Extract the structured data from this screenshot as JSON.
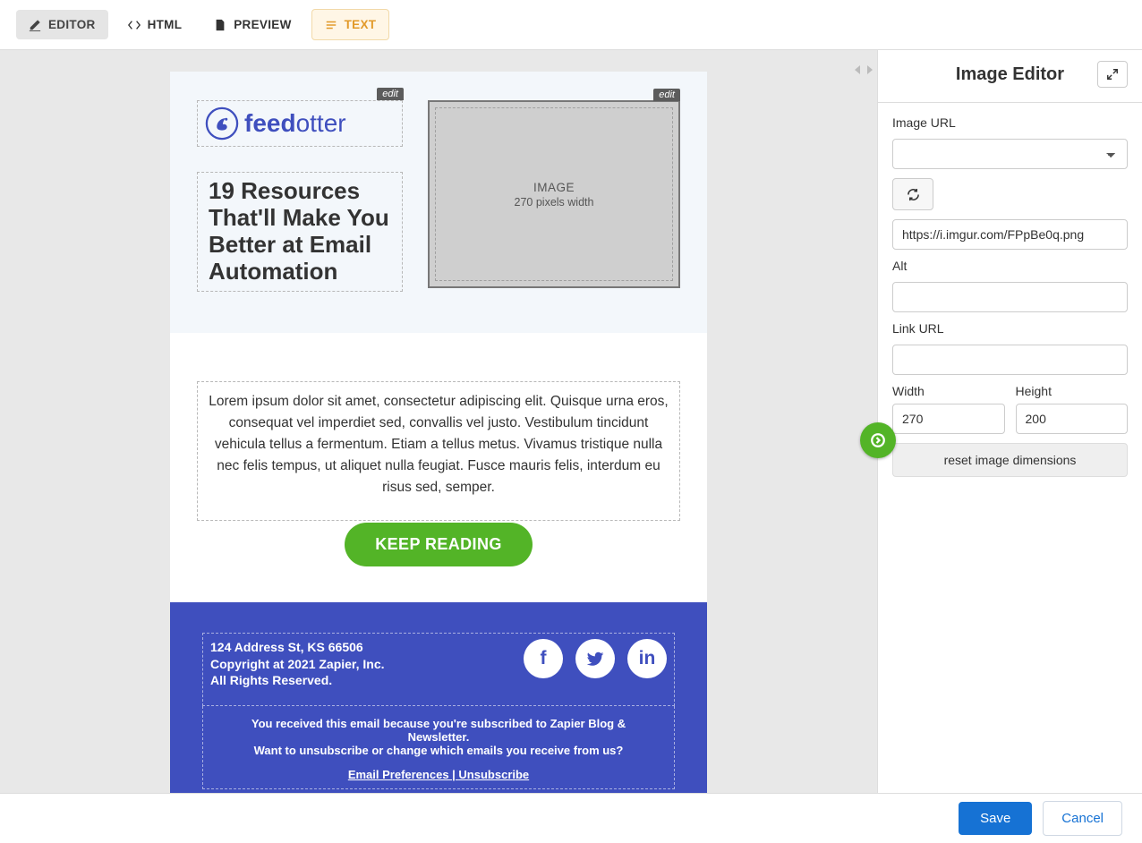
{
  "toolbar": {
    "editor": "EDITOR",
    "html": "HTML",
    "preview": "PREVIEW",
    "text": "TEXT"
  },
  "canvas": {
    "edit_tag": "edit",
    "logo_name": "feedotter",
    "headline": "19 Resources That'll Make You Better at Email Automation",
    "image_slot": {
      "label": "IMAGE",
      "sub": "270 pixels width"
    },
    "body_text": "Lorem ipsum dolor sit amet, consectetur adipiscing elit. Quisque urna eros, consequat vel imperdiet sed, convallis vel justo. Vestibulum tincidunt vehicula tellus a fermentum. Etiam a tellus metus. Vivamus tristique nulla nec felis tempus, ut aliquet nulla feugiat. Fusce mauris felis, interdum eu risus sed, semper.",
    "cta": "KEEP READING",
    "footer": {
      "line1": "124 Address St, KS 66506",
      "line2": "Copyright at 2021 Zapier, Inc.",
      "line3": "All Rights Reserved.",
      "msg1": "You received this email because you're subscribed to Zapier Blog & Newsletter.",
      "msg2": "Want to unsubscribe or change which emails you receive from us?",
      "link_pref": "Email Preferences",
      "link_sep": " | ",
      "link_unsub": "Unsubscribe"
    }
  },
  "side": {
    "title": "Image Editor",
    "image_url_label": "Image URL",
    "url_value": "https://i.imgur.com/FPpBe0q.png",
    "alt_label": "Alt",
    "link_url_label": "Link URL",
    "width_label": "Width",
    "width_value": "270",
    "height_label": "Height",
    "height_value": "200",
    "reset": "reset image dimensions"
  },
  "bottom": {
    "save": "Save",
    "cancel": "Cancel"
  }
}
